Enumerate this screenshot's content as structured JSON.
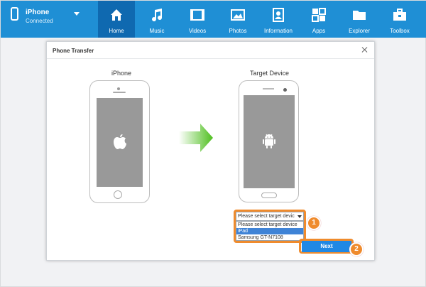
{
  "device": {
    "name": "iPhone",
    "status": "Connected"
  },
  "nav": {
    "items": [
      {
        "label": "Home",
        "icon": "home-icon",
        "active": true
      },
      {
        "label": "Music",
        "icon": "music-icon",
        "active": false
      },
      {
        "label": "Videos",
        "icon": "video-icon",
        "active": false
      },
      {
        "label": "Photos",
        "icon": "photo-icon",
        "active": false
      },
      {
        "label": "Information",
        "icon": "contacts-icon",
        "active": false
      },
      {
        "label": "Apps",
        "icon": "apps-icon",
        "active": false
      },
      {
        "label": "Explorer",
        "icon": "folder-icon",
        "active": false
      },
      {
        "label": "Toolbox",
        "icon": "toolbox-icon",
        "active": false
      }
    ]
  },
  "dialog": {
    "title": "Phone Transfer",
    "source_label": "iPhone",
    "target_label": "Target Device",
    "select": {
      "value": "Please select target devic",
      "options": [
        "Please select target device",
        "iPad",
        "Samsung GT-N7108"
      ],
      "selected_index": 1
    },
    "next_label": "Next",
    "badges": [
      "1",
      "2"
    ]
  },
  "colors": {
    "topbar": "#1f8fd5",
    "active_tab": "#0f69b0",
    "accent": "#ef8b2d",
    "button": "#2088e4"
  }
}
